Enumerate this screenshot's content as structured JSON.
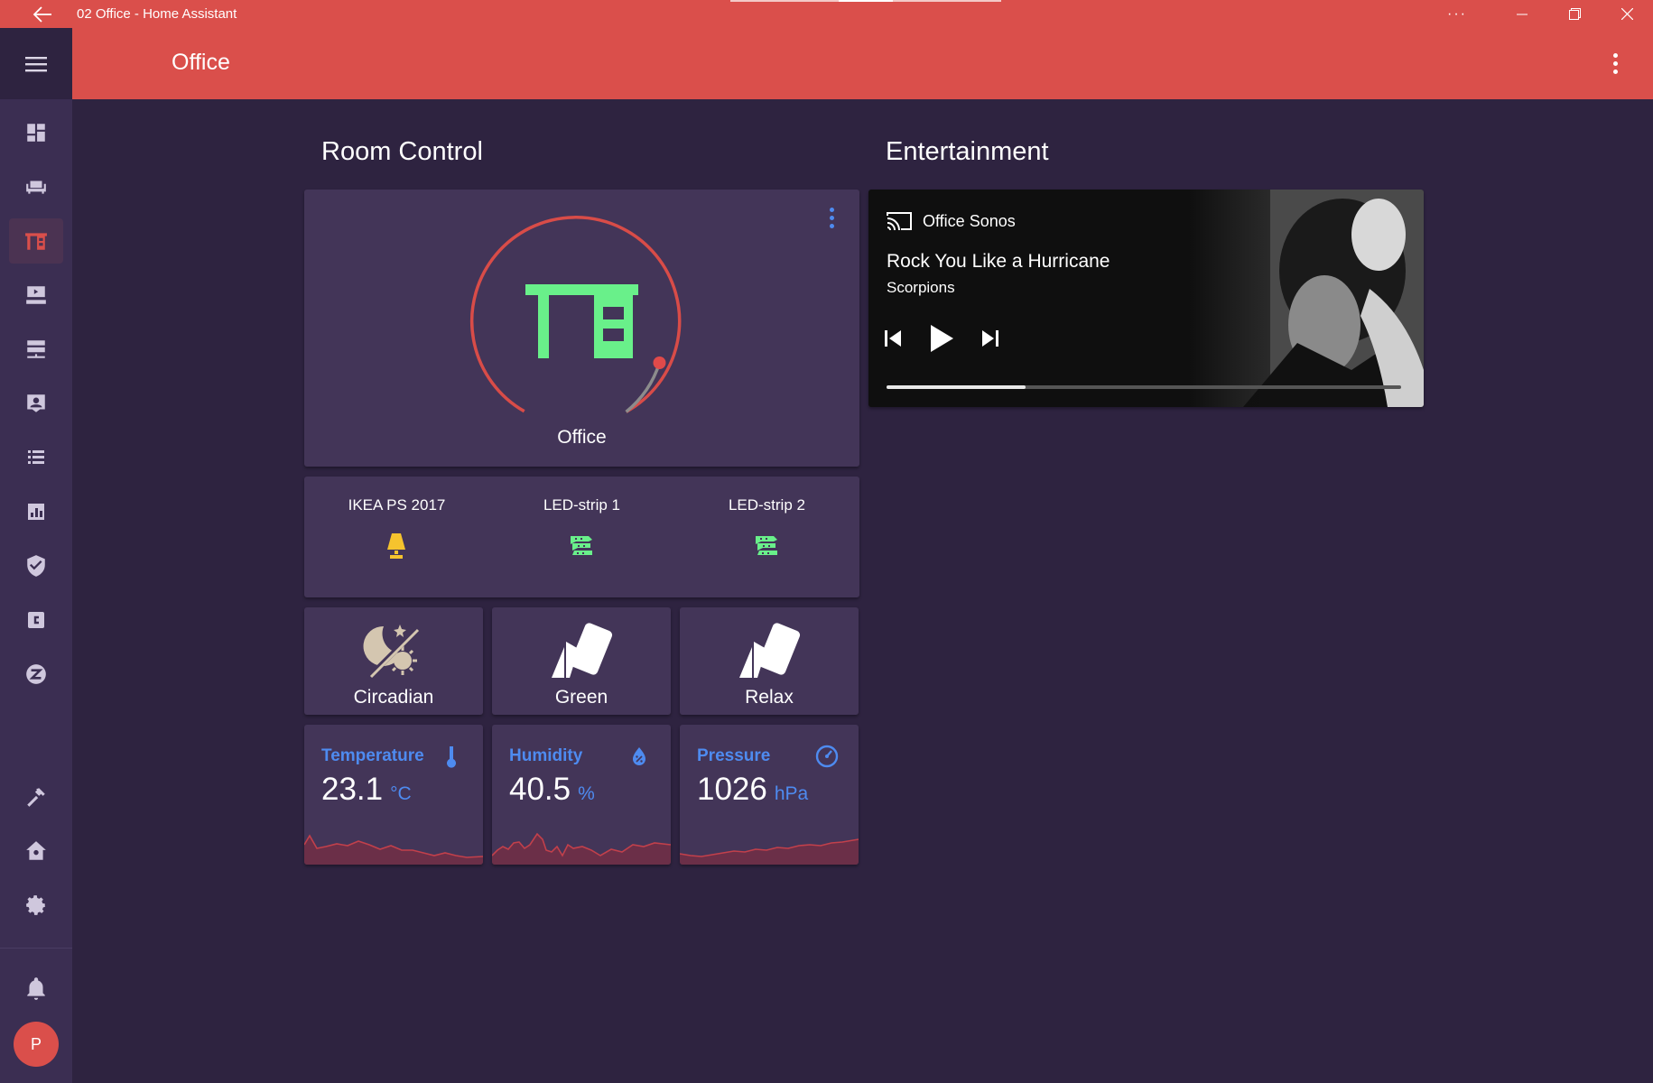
{
  "window": {
    "title": "02 Office - Home Assistant"
  },
  "header": {
    "title": "Office"
  },
  "sidebar": {
    "items": [
      {
        "icon": "dashboard-icon",
        "active": false
      },
      {
        "icon": "sofa-icon",
        "active": false
      },
      {
        "icon": "desk-icon",
        "active": true
      },
      {
        "icon": "theater-icon",
        "active": false
      },
      {
        "icon": "server-icon",
        "active": false
      },
      {
        "icon": "account-box-icon",
        "active": false
      },
      {
        "icon": "list-icon",
        "active": false
      },
      {
        "icon": "chart-bar-icon",
        "active": false
      },
      {
        "icon": "shield-check-icon",
        "active": false
      },
      {
        "icon": "code-c-icon",
        "active": false
      },
      {
        "icon": "z-wave-icon",
        "active": false
      }
    ],
    "bottom_items": [
      {
        "icon": "hammer-icon"
      },
      {
        "icon": "home-gear-icon"
      },
      {
        "icon": "cog-icon"
      }
    ],
    "notifications_icon": "bell-icon",
    "avatar_letter": "P"
  },
  "sections": {
    "room_control": "Room Control",
    "entertainment": "Entertainment"
  },
  "thermostat": {
    "name": "Office",
    "icon": "desk-icon",
    "icon_color": "#69f08a",
    "ring_color": "#d84c48"
  },
  "glance": {
    "items": [
      {
        "name": "IKEA PS 2017",
        "icon": "lamp-icon",
        "color": "#f5c32e"
      },
      {
        "name": "LED-strip 1",
        "icon": "led-strip-icon",
        "color": "#69f08a"
      },
      {
        "name": "LED-strip 2",
        "icon": "led-strip-icon",
        "color": "#69f08a"
      }
    ]
  },
  "scenes": [
    {
      "name": "Circadian",
      "icon": "theme-light-dark-icon"
    },
    {
      "name": "Green",
      "icon": "palette-swatch-icon"
    },
    {
      "name": "Relax",
      "icon": "palette-swatch-icon"
    }
  ],
  "sensors": [
    {
      "name": "Temperature",
      "value": "23.1",
      "unit": "°C",
      "icon": "thermometer-icon"
    },
    {
      "name": "Humidity",
      "value": "40.5",
      "unit": "%",
      "icon": "water-percent-icon"
    },
    {
      "name": "Pressure",
      "value": "1026",
      "unit": "hPa",
      "icon": "gauge-icon"
    }
  ],
  "media": {
    "source": "Office Sonos",
    "title": "Rock You Like a Hurricane",
    "artist": "Scorpions",
    "progress": 0.27
  },
  "colors": {
    "accent": "#da4f4b",
    "background": "#2e2340",
    "card": "#433558",
    "sidebar": "#3b2e52",
    "primary_text_blue": "#4e8bf0"
  }
}
